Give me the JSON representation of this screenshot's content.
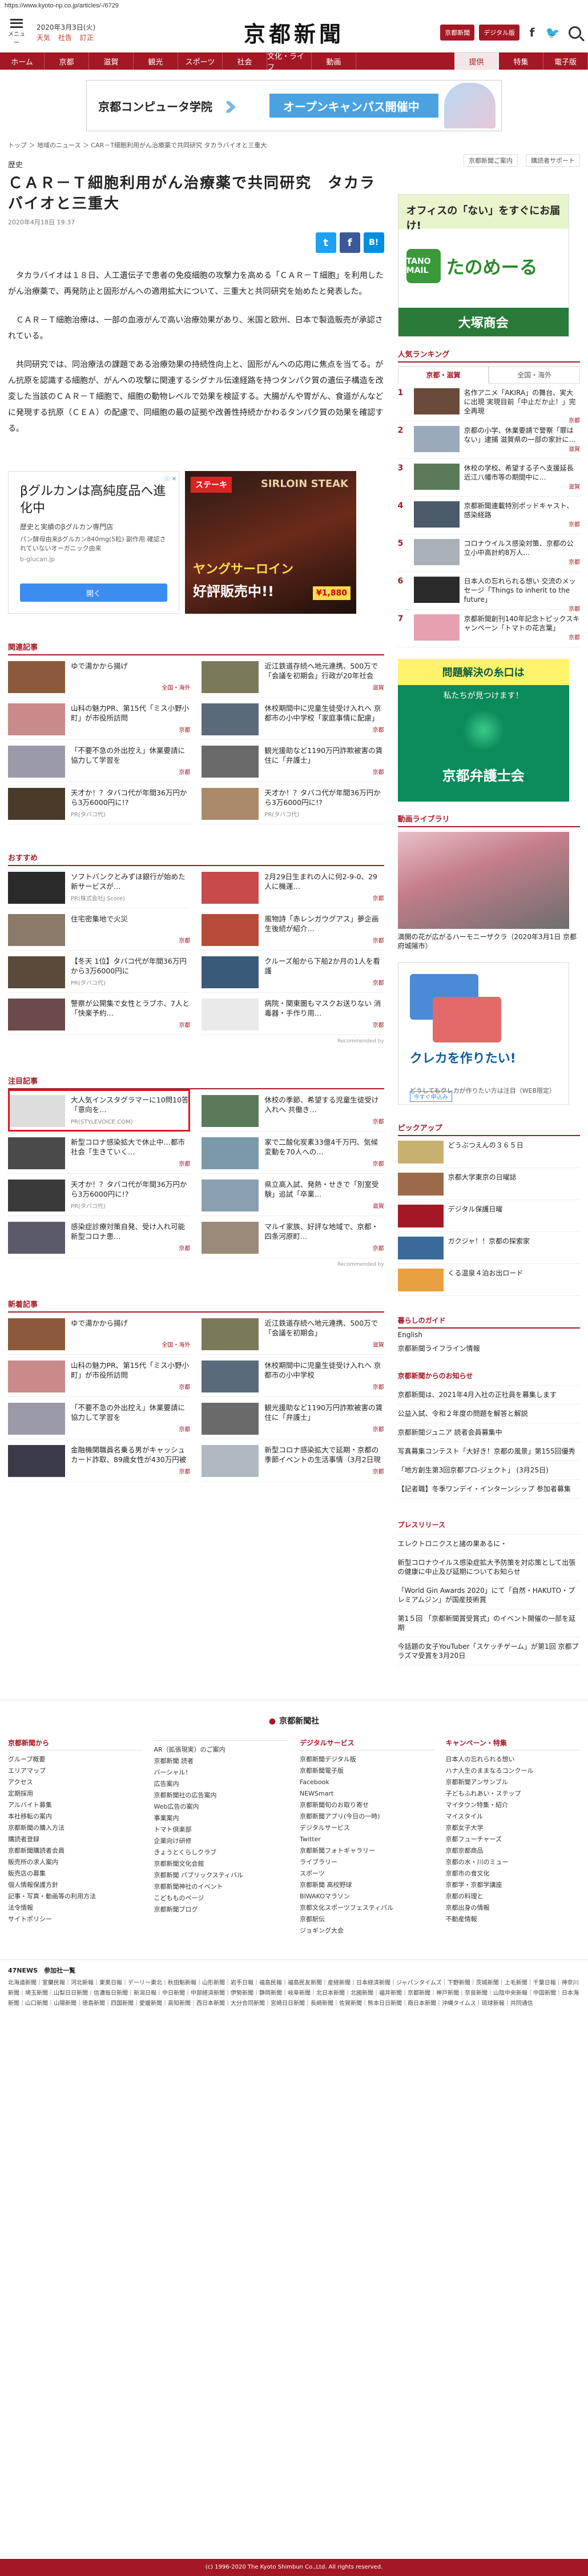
{
  "url": "https://www.kyoto-np.co.jp/articles/-/6729",
  "header": {
    "menu_label": "メニュー",
    "date": "2020年3月3日(火)",
    "weather": [
      "天気",
      "社告",
      "訂正"
    ],
    "logo": "京都新聞",
    "btn_login": "京都新聞",
    "btn_digital": "デジタル版",
    "social": [
      "f",
      "🐦"
    ]
  },
  "nav": {
    "items": [
      "ホーム",
      "京都",
      "滋賀",
      "観光",
      "スポーツ",
      "社会",
      "文化・ライフ",
      "動画"
    ],
    "right": [
      "提供",
      "特集",
      "電子版"
    ]
  },
  "banner": {
    "name": "京都コンピュータ学院",
    "message": "オープンキャンパス開催中"
  },
  "breadcrumb": "トップ ＞ 地域のニュース ＞ CAR－T細胞利用がん治療薬で共同研究 タカラバイオと三重大",
  "side_links": [
    "京都新聞ご案内",
    "購読者サポート"
  ],
  "article": {
    "category": "歴史",
    "title": "ＣＡＲ－Ｔ細胞利用がん治療薬で共同研究　タカラバイオと三重大",
    "date": "2020年4月18日 19:37",
    "share": [
      "t",
      "f",
      "B!"
    ],
    "body": [
      "タカラバイオは１８日、人工遺伝子で患者の免疫細胞の攻撃力を高める「ＣＡＲ－Ｔ細胞」を利用したがん治療薬で、再発防止と固形がんへの適用拡大について、三重大と共同研究を始めたと発表した。",
      "ＣＡＲ－Ｔ細胞治療は、一部の血液がんで高い治療効果があり、米国と欧州、日本で製造販売が承認されている。",
      "共同研究では、同治療法の課題である治療効果の持続性向上と、固形がんへの応用に焦点を当てる。がん抗原を認識する細胞が、がんへの攻撃に関連するシグナル伝達経路を持つタンパク質の遺伝子構造を改変した当該のＣＡＲ－Ｔ細胞で、細胞の動物レベルで効果を検証する。大腸がんや胃がん、食道がんなどに発現する抗原（ＣＥＡ）の配慮で、同細胞の最の証拠や改善性持続かかわるタンパク質の効果を確認する。"
    ]
  },
  "ad_left": {
    "headline": "βグルカンは高純度品へ進化中",
    "sub": "歴史と実績のβグルカン専門店",
    "url": "b-glucan.jp",
    "body": "パン酵母由来βグルカン840mg(5粒) 副作用 確認されていないオーガニック由来",
    "btn": "開く"
  },
  "ad_right": {
    "tag": "SIRLOIN STEAK",
    "top": "ステーキ",
    "headline": "ヤングサーロイン",
    "sub": "好評販売中!!",
    "price": "¥1,880"
  },
  "related": {
    "title": "関連記事",
    "items": [
      {
        "text": "ゆで湯かから揚げ",
        "tag": "全国・海外"
      },
      {
        "text": "近江鉄道存続へ地元連携、500万で「会議を初期会」行政が20年社会で。",
        "tag": "滋賀"
      },
      {
        "text": "山科の魅力PR、第15代「ミス小野小町」が市役所訪問",
        "tag": "京都"
      },
      {
        "text": "休校期間中に児童生徒受け入れへ 京都市の小中学校「家庭事情に配慮」",
        "tag": "京都"
      },
      {
        "text": "「不要不急の外出控え」休業要請に協力して学習を",
        "tag": "京都"
      },
      {
        "text": "観光援助など1190万円詐欺被害の賃住に「弁護士」",
        "tag": "京都"
      },
      {
        "text": "天才か！？タバコ代が年間36万円から3万6000円に!?",
        "tag": "PR(タバコ代)"
      },
      {
        "text": "天才か！？タバコ代が年間36万円から3万6000円に!?",
        "tag": "PR(タバコ代)"
      }
    ]
  },
  "recommend": {
    "title": "おすすめ",
    "items": [
      {
        "text": "ソフトバンクとみずほ銀行が始めた新サービスが…",
        "tag": "PR(株式会社J.Score)"
      },
      {
        "text": "2月29日生まれの人に何2-9-0、29人に機運…",
        "tag": "京都"
      },
      {
        "text": "住宅密集地で火災",
        "tag": "京都"
      },
      {
        "text": "風物詩「赤レンガウグアス」夢企画 生後続が紹介…",
        "tag": "京都"
      },
      {
        "text": "【冬天 1位】タバコ代が年間36万円から3万6000円に",
        "tag": "PR(タバコ代)"
      },
      {
        "text": "クルーズ船から下船2か月の1人を看護",
        "tag": "京都"
      },
      {
        "text": "警察が公開集で女性とラブホ、7人と「快楽予約…",
        "tag": "京都"
      },
      {
        "text": "病院・関東圏もマスクお送りない 消毒器・手作り用…",
        "tag": "京都"
      }
    ],
    "by": "Recommended by"
  },
  "attention": {
    "title": "注目記事",
    "items": [
      {
        "text": "大人気インスタグラマーに10問10答「意向を…",
        "tag": "PR(STYLEVOICE.COM)"
      },
      {
        "text": "休校の季節、希望する児童生徒受け入れへ 共働き…",
        "tag": "京都"
      },
      {
        "text": "新型コロナ感染拡大で休止中…都市社会「生きていく…",
        "tag": "京都"
      },
      {
        "text": "家で二酸化炭素33億4千万円、気候変動を70人への…",
        "tag": "京都"
      },
      {
        "text": "天才か！？タバコ代が年間36万円から3万6000円に!?",
        "tag": "PR(タバコ代)"
      },
      {
        "text": "県立高入試、発熱・せきで「別室受験」追試「卒業…",
        "tag": "滋賀"
      },
      {
        "text": "感染症診療対策自発、受け入れ可能 新型コロナ患…",
        "tag": "京都"
      },
      {
        "text": "マルイ家族、好評な地域で、京都・四条河原町…",
        "tag": "京都"
      }
    ],
    "by": "Recommended by"
  },
  "newest": {
    "title": "新着記事",
    "items": [
      {
        "text": "ゆで湯かから揚げ",
        "tag": "全国・海外"
      },
      {
        "text": "近江鉄道存続へ地元連携、500万で「会議を初期会」",
        "tag": "滋賀"
      },
      {
        "text": "山科の魅力PR、第15代「ミス小野小町」が市役所訪問",
        "tag": "京都"
      },
      {
        "text": "休校期間中に児童生徒受け入れへ 京都市の小中学校",
        "tag": "京都"
      },
      {
        "text": "「不要不急の外出控え」休業要請に協力して学習を",
        "tag": "京都"
      },
      {
        "text": "観光援助など1190万円詐欺被害の賃住に「弁護士」",
        "tag": "京都"
      },
      {
        "text": "金融機関職員名乗る男がキャッシュカード詐取、89歳女性が430万円被害",
        "tag": "京都"
      },
      {
        "text": "新型コロナ感染拡大で延期・京都の季節イベントの生活事情（3月2日現在）",
        "tag": "京都"
      }
    ]
  },
  "sidebar": {
    "ad_top": {
      "head": "オフィスの「ない」をすぐにお届け!",
      "logo": "TANO MAIL",
      "name": "たのめーる",
      "bottom": "大塚商会"
    },
    "ranking": {
      "title": "人気ランキング",
      "tabs": [
        "京都・滋賀",
        "全国・海外"
      ],
      "items": [
        {
          "num": "1",
          "text": "名作アニメ「AKIRA」の舞台、実大に出現 実現目前「中止だか止！」完全再現",
          "loc": "京都"
        },
        {
          "num": "2",
          "text": "京都の小学、休業要請で警察「罪はない」逮捕 滋賀県の一部の家計に…",
          "loc": "滋賀"
        },
        {
          "num": "3",
          "text": "休校の学校、希望する子へ支援延長 近江八幡市等の期間中に…",
          "loc": "滋賀"
        },
        {
          "num": "4",
          "text": "京都新聞連載特別ポッドキャスト、感染経路",
          "loc": "京都"
        },
        {
          "num": "5",
          "text": "コロナウイルス感染対策、京都の公立小中高計約8万人…",
          "loc": "京都"
        },
        {
          "num": "6",
          "text": "日本人の忘れられる想い 交流のメッセージ「Things to inherit to the future」",
          "loc": "京都"
        },
        {
          "num": "7",
          "text": "京都新聞創刊140年記念トピックスキャンペーン「トマトの花言葉」",
          "loc": "京都"
        }
      ]
    },
    "lawyer": {
      "head": "問題解決の糸口は",
      "sub": "私たちが見つけます！",
      "name": "京都弁護士会"
    },
    "video": {
      "title": "動画ライブラリ",
      "caption": "満開の花が広がるハーモニーザクラ（2020年3月1日 京都府城陽市）"
    },
    "cc_ad": {
      "head": "クレカを作りたい!",
      "body": "どうしてもクレカが作りたい方は注目（WEB限定）",
      "btn": "今すぐ申込み"
    },
    "pickup": {
      "title": "ピックアップ",
      "items": [
        "どうぶつえんの３６５日",
        "京都大学東京の日曜誌",
        "デジタル保護日曜",
        "ガクジャ！！京都の探索家",
        "くる温泉４泊お出ロード"
      ]
    },
    "guide": {
      "title": "暮らしのガイド",
      "items": [
        "English",
        "京都新聞ライフライン情報"
      ]
    },
    "notice": {
      "title": "京都新聞からのお知らせ",
      "items": [
        "京都新聞は、2021年4月入社の正社員を募集します",
        "公益入試、令和２年度の問題を解答と解説",
        "京都新聞ジュニア 読者会員募集中",
        "写真募集コンテスト「大好き！京都の風景」第155回優秀",
        "「地方創生第3回京都プロ-ジェクト」 (3月25日)",
        "【記者職】冬季ワンデイ・インターンシップ 参加者募集"
      ]
    },
    "press": {
      "title": "プレスリリース",
      "items": [
        "エレクトロニクスと諸の果あるに・",
        "新型コロナウイルス感染症拡大予防策を対応策として出張の健康に中止及び延期についてお知らせ",
        "「World Gin Awards 2020」にて「自然・HAKUTO・プレミアムジン」が国産技術賞",
        "第1５回 「京都新聞賞受賞式」のイベント開催の一部を延期",
        "今話題の女子YouTuber「スケッチゲーム」が第1回 京都プラズマ受賞を3月20日"
      ]
    }
  },
  "footer": {
    "logo": "京都新聞社",
    "cols": [
      {
        "head": "京都新聞から",
        "items": [
          "グループ概要",
          "エリアマップ",
          "アクセス",
          "定期採用",
          "アルバイト募集",
          "本社移転の案内",
          "京都新聞の購入方法",
          "購読者登録",
          "京都新聞購読者会員",
          "販売所の求人案内",
          "販売店の募集",
          "個人情報保護方針",
          "記事・写真・動画等の利用方法",
          "法令情報",
          "サイトポリシー"
        ]
      },
      {
        "head": "",
        "items": [
          "AR（拡張現実）のご案内",
          "京都新聞 読者",
          "バーシャル！",
          "広告案内",
          "京都新聞社の広告案内",
          "Web広告の案内",
          "事業案内",
          "トマト倶楽部",
          "企業向け研修",
          "きょうとくらしクラブ",
          "京都新聞文化会館",
          "京都新聞 パブリックスティバル",
          "京都新聞神社のイベント",
          "こどもものページ",
          "京都新聞ブログ"
        ]
      },
      {
        "head": "デジタルサービス",
        "items": [
          "京都新聞デジタル版",
          "京都新聞電子版",
          "Facebook",
          "NEWSmart",
          "京都新聞旬のお取り寄せ",
          "京都新聞アプリ(今日の一時)",
          "デジタルサービス",
          "Twitter",
          "京都新聞フォトギャラリー",
          "ライブラリー",
          "スポーツ",
          "京都新聞 高校野球",
          "BIWAKOマラソン",
          "京都文化スポーツフェスティバル",
          "京都駅伝",
          "ジョギング大会"
        ]
      },
      {
        "head": "キャンペーン・特集",
        "items": [
          "日本人の忘れられる想い",
          "ハナ人生のままなるコンクール",
          "京都新聞アンサンブル",
          "子どもふれあい・ステップ",
          "マイタウン特集・紹介",
          "マイスタイル",
          "京都女子大学",
          "京都フューチャーズ",
          "京都京都商品",
          "京都の水・川のミュー",
          "京都市の食文化",
          "京都学・京都学講座",
          "京都の料理と",
          "京都出身の情報",
          "不動産情報"
        ]
      }
    ]
  },
  "news47": {
    "head": "47NEWS　参加社一覧",
    "list": "北海道新聞｜室蘭民報｜河北新報｜東奥日報｜デーリー東北｜秋田魁新報｜山形新聞｜岩手日報｜福島民報｜福島民友新聞｜産経新聞｜日本経済新聞｜ジャパンタイムズ｜下野新聞｜茨城新聞｜上毛新聞｜千葉日報｜神奈川新聞｜埼玉新聞｜山梨日日新聞｜信濃毎日新聞｜新潟日報｜中日新聞｜中部経済新聞｜伊勢新聞｜静岡新聞｜岐阜新聞｜北日本新聞｜北國新聞｜福井新聞｜京都新聞｜神戸新聞｜奈良新聞｜山陰中央新報｜中国新聞｜日本海新聞｜山口新聞｜山陽新聞｜徳島新聞｜四国新聞｜愛媛新聞｜高知新聞｜西日本新聞｜大分合同新聞｜宮崎日日新聞｜長崎新聞｜佐賀新聞｜熊本日日新聞｜南日本新聞｜沖縄タイムス｜琉球新報｜共同通信"
  },
  "copyright": "(c) 1996-2020 The Kyoto Shimbun Co.,Ltd. All rights reserved.",
  "colors": {
    "brand": "#a31824",
    "accent": "#1da1f2"
  }
}
